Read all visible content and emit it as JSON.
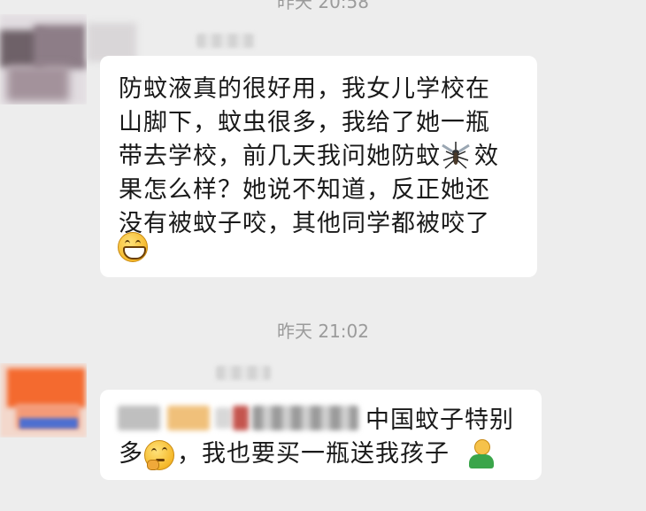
{
  "timestamps": {
    "top": "昨天 20:58",
    "middle": "昨天 21:02"
  },
  "messages": [
    {
      "lines": [
        "防蚊液真的很好用，我女儿学校在",
        "山脚下，蚊虫很多，我给了她一瓶",
        "带去学校，前几天我问她防蚊",
        "效",
        "果怎么样？她说不知道，反正她还",
        "没有被蚊子咬，其他同学都被咬了"
      ],
      "emojis": [
        "mosquito-emoji",
        "grinning-face-emoji"
      ]
    },
    {
      "lines": [
        "中国蚊子特别",
        "多",
        "，我也要买一瓶送我孩子"
      ],
      "emojis": [
        "thinking-face-emoji",
        "person-emoji"
      ]
    }
  ],
  "colors": {
    "background": "#ededed",
    "bubble": "#ffffff",
    "timestamp": "#9b9b9b",
    "text": "#191919"
  }
}
